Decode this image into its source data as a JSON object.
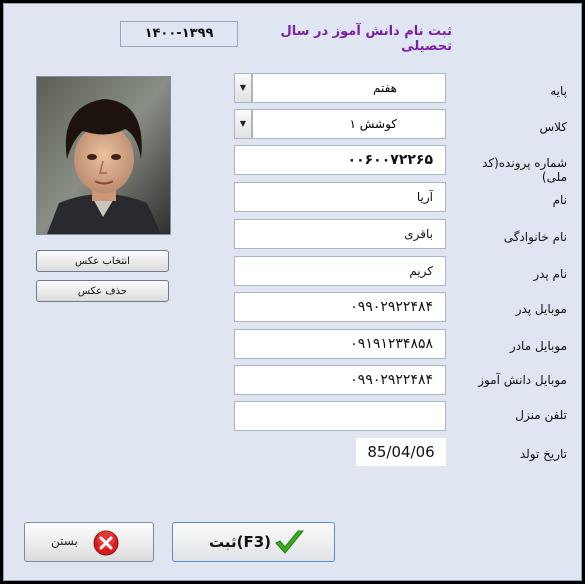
{
  "form": {
    "title": "ثبت نام دانش آموز  در سال تحصیلی",
    "school_year": "۱۴۰۰-۱۳۹۹"
  },
  "fields": {
    "grade": {
      "label": "پایه",
      "value": "هفتم"
    },
    "class": {
      "label": "کلاس",
      "value": "کوشش ۱"
    },
    "file_number": {
      "label": "شماره پرونده(کد ملی)",
      "value": "۰۰۶۰۰۷۲۲۶۵"
    },
    "first_name": {
      "label": "نام",
      "value": "آریا"
    },
    "last_name": {
      "label": "نام خانوادگی",
      "value": "باقری"
    },
    "father_name": {
      "label": "نام پدر",
      "value": "کریم"
    },
    "father_mobile": {
      "label": "موبایل پدر",
      "value": "۰۹۹۰۲۹۲۲۴۸۴"
    },
    "mother_mobile": {
      "label": "موبایل مادر",
      "value": "۰۹۱۹۱۲۳۴۸۵۸"
    },
    "student_mobile": {
      "label": "موبایل دانش آموز",
      "value": "۰۹۹۰۲۹۲۲۴۸۴"
    },
    "home_phone": {
      "label": "تلفن منزل",
      "value": ""
    },
    "birth_date": {
      "label": "تاریخ تولد",
      "value": "85/04/06"
    }
  },
  "photo": {
    "select_label": "انتخاب عکس",
    "delete_label": "حذف عکس"
  },
  "buttons": {
    "close_label": "بستن",
    "save_label": "ثبت(F3)"
  },
  "icons": {
    "dropdown": "dropdown-arrow-icon",
    "close": "red-x-icon",
    "save": "green-checkmark-icon"
  },
  "colors": {
    "title": "#7a1fa6",
    "background": "#dfe6f2",
    "save_border": "#5c8ad1",
    "close_icon": "#d81c1c",
    "check_icon": "#3fae1e"
  }
}
